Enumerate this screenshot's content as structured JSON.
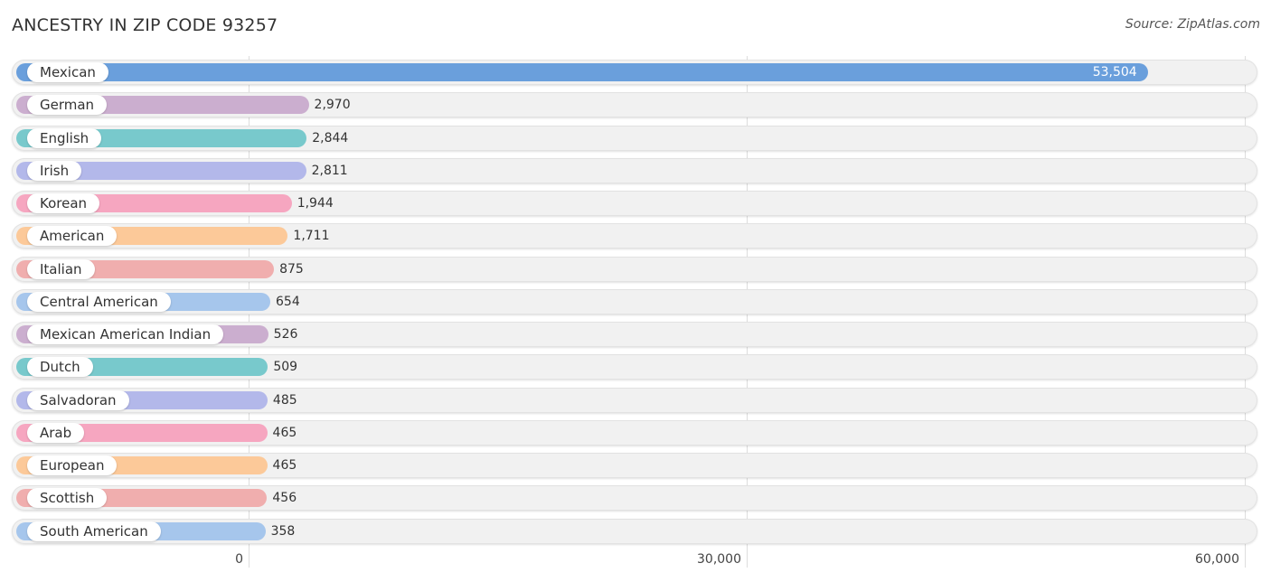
{
  "header": {
    "title": "ANCESTRY IN ZIP CODE 93257",
    "source": "Source: ZipAtlas.com"
  },
  "chart_data": {
    "type": "bar",
    "orientation": "horizontal",
    "title": "ANCESTRY IN ZIP CODE 93257",
    "source": "Source: ZipAtlas.com",
    "xlabel": "",
    "ylabel": "",
    "xlim": [
      0,
      60000
    ],
    "ticks": [
      0,
      30000,
      60000
    ],
    "tick_labels": [
      "0",
      "30,000",
      "60,000"
    ],
    "grid": true,
    "legend": "none",
    "categories": [
      "Mexican",
      "German",
      "English",
      "Irish",
      "Korean",
      "American",
      "Italian",
      "Central American",
      "Mexican American Indian",
      "Dutch",
      "Salvadoran",
      "Arab",
      "European",
      "Scottish",
      "South American"
    ],
    "values": [
      53504,
      2970,
      2844,
      2811,
      1944,
      1711,
      875,
      654,
      526,
      509,
      485,
      465,
      465,
      456,
      358
    ],
    "value_labels": [
      "53,504",
      "2,970",
      "2,844",
      "2,811",
      "1,944",
      "1,711",
      "875",
      "654",
      "526",
      "509",
      "485",
      "465",
      "465",
      "456",
      "358"
    ],
    "colors": [
      "#6a9fdc",
      "#cbaecf",
      "#78c9cc",
      "#b3b8ea",
      "#f6a6c0",
      "#fcc999",
      "#f0aeae",
      "#a6c6ec",
      "#cbaecf",
      "#78c9cc",
      "#b3b8ea",
      "#f6a6c0",
      "#fcc999",
      "#f0aeae",
      "#a6c6ec"
    ]
  }
}
